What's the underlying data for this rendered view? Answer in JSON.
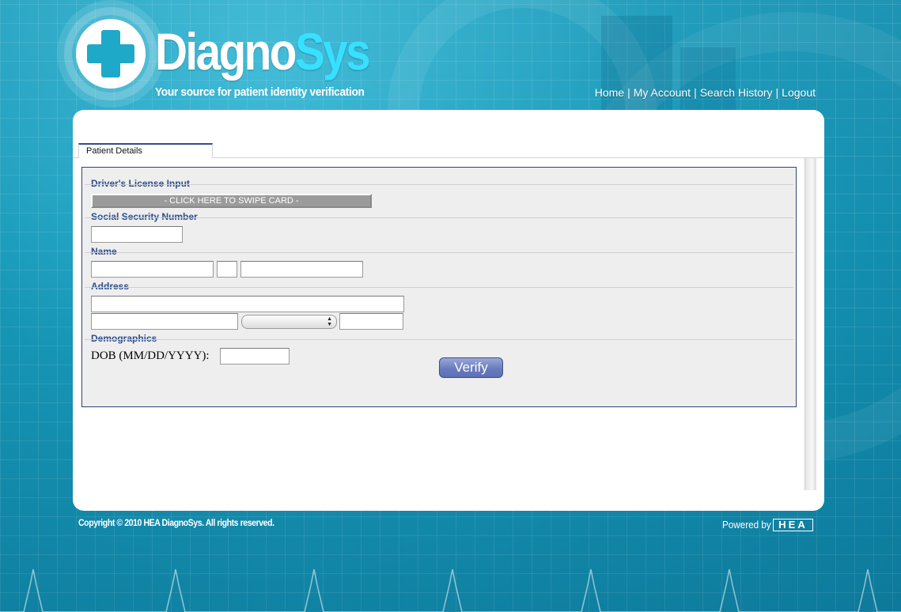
{
  "header": {
    "brand_primary": "Diagno",
    "brand_secondary": "Sys",
    "tagline": "Your source for patient identity verification"
  },
  "nav": {
    "items": [
      "Home",
      "My Account",
      "Search History",
      "Logout"
    ],
    "separator": "|"
  },
  "tabs": [
    {
      "label": "Patient Details",
      "active": true
    }
  ],
  "form": {
    "sections": {
      "drivers_license": "Driver's License Input",
      "ssn": "Social Security Number",
      "name": "Name",
      "address": "Address",
      "demographics": "Demographics"
    },
    "swipe_button": "- CLICK HERE TO SWIPE CARD -",
    "dob_label": "DOB (MM/DD/YYYY):",
    "fields": {
      "ssn": "",
      "first_name": "",
      "middle_initial": "",
      "last_name": "",
      "street": "",
      "city": "",
      "state": "",
      "zip": "",
      "dob": ""
    },
    "verify_button": "Verify"
  },
  "footer": {
    "copyright": "Copyright © 2010 HEA DiagnoSys. All rights reserved.",
    "powered_by": "Powered by",
    "vendor_logo": "HEA"
  },
  "colors": {
    "background": "#1593b3",
    "brand_accent": "#38e0ff",
    "section_label": "#2b4c8d",
    "form_border": "#2f4377",
    "verify_button": "#6a7cbf"
  }
}
